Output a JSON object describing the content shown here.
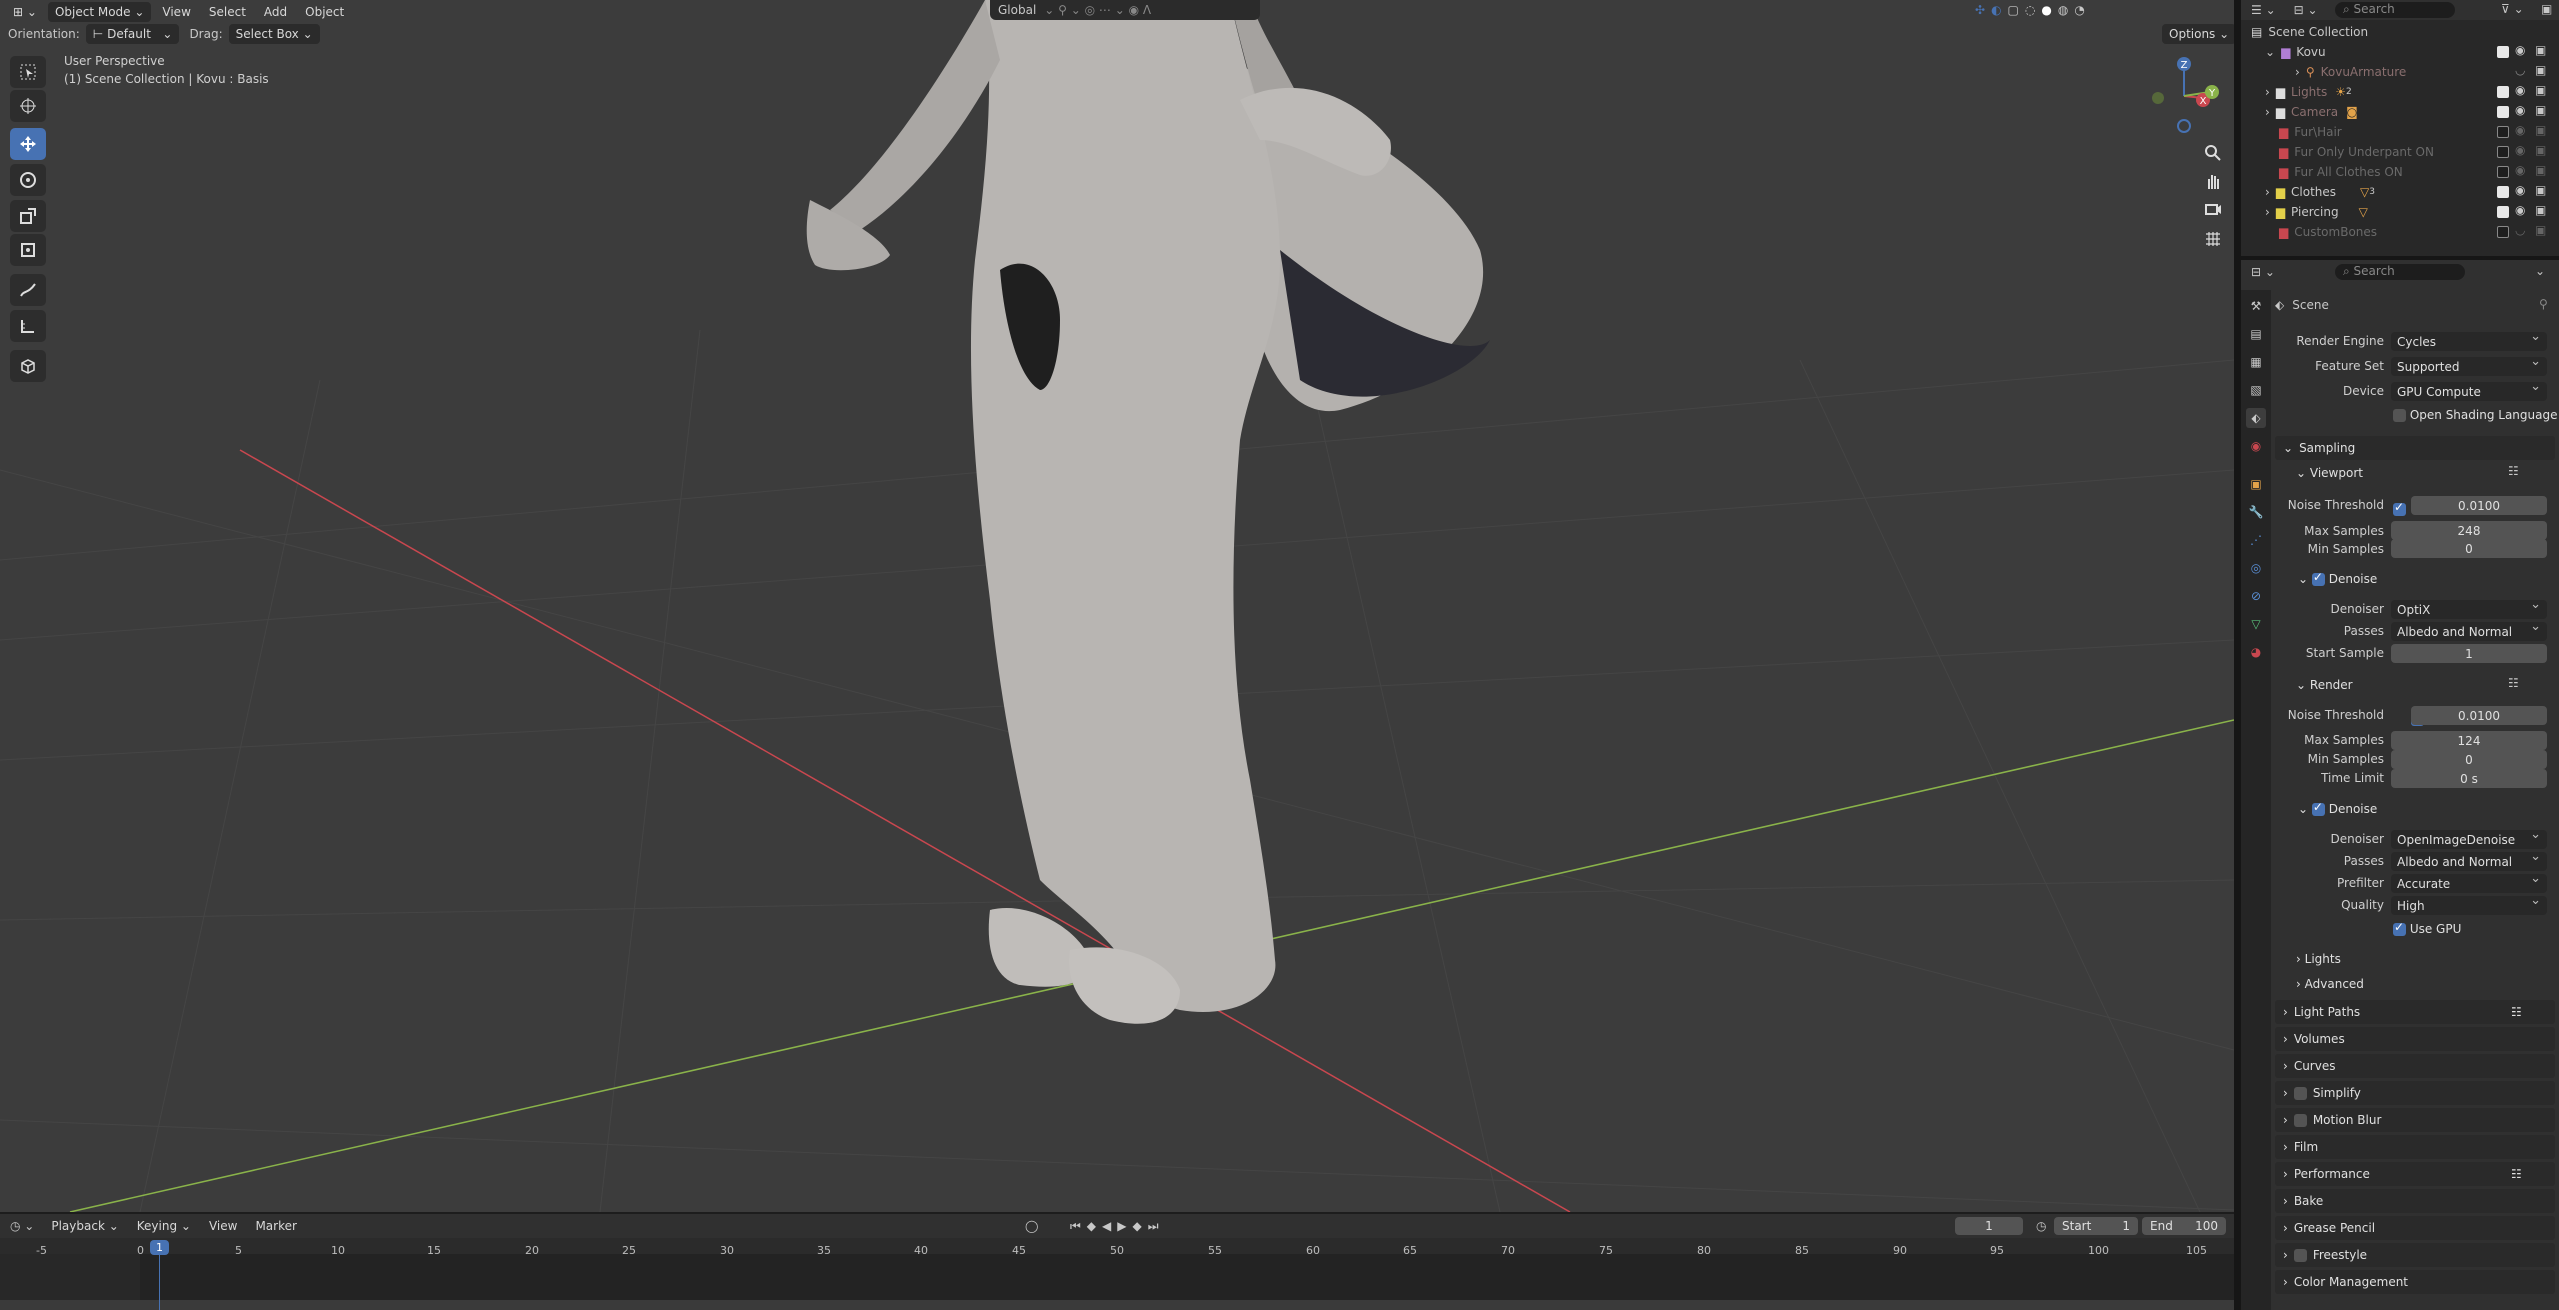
{
  "header": {
    "mode": "Object Mode",
    "menus": [
      "View",
      "Select",
      "Add",
      "Object"
    ],
    "orientation_label": "Orientation:",
    "orientation_value": "Default",
    "drag_label": "Drag:",
    "drag_value": "Select Box",
    "transform_space": "Global",
    "options": "Options",
    "search_placeholder": "Search"
  },
  "viewport": {
    "perspective": "User Perspective",
    "collection_info": "(1) Scene Collection | Kovu : Basis",
    "gizmo_axes": [
      "Z",
      "X",
      "Y"
    ]
  },
  "outliner": {
    "root": "Scene Collection",
    "items": [
      {
        "label": "Kovu",
        "enabled": true
      },
      {
        "label": "KovuArmature",
        "enabled": true
      },
      {
        "label": "Lights",
        "enabled": true,
        "badge": "2"
      },
      {
        "label": "Camera",
        "enabled": true
      },
      {
        "label": "Fur\\Hair",
        "enabled": false
      },
      {
        "label": "Fur Only Underpant ON",
        "enabled": false
      },
      {
        "label": "Fur All Clothes ON",
        "enabled": false
      },
      {
        "label": "Clothes",
        "enabled": true,
        "badge": "3"
      },
      {
        "label": "Piercing",
        "enabled": true
      },
      {
        "label": "CustomBones",
        "enabled": false
      }
    ]
  },
  "properties": {
    "search_placeholder": "Search",
    "context": "Scene",
    "render_engine": {
      "label": "Render Engine",
      "value": "Cycles"
    },
    "feature_set": {
      "label": "Feature Set",
      "value": "Supported"
    },
    "device": {
      "label": "Device",
      "value": "GPU Compute"
    },
    "osl": "Open Shading Language",
    "sampling": "Sampling",
    "viewport": {
      "title": "Viewport",
      "noise_threshold": {
        "label": "Noise Threshold",
        "value": "0.0100"
      },
      "max_samples": {
        "label": "Max Samples",
        "value": "248"
      },
      "min_samples": {
        "label": "Min Samples",
        "value": "0"
      },
      "denoise": "Denoise",
      "denoiser": {
        "label": "Denoiser",
        "value": "OptiX"
      },
      "passes": {
        "label": "Passes",
        "value": "Albedo and Normal"
      },
      "start_sample": {
        "label": "Start Sample",
        "value": "1"
      }
    },
    "render": {
      "title": "Render",
      "noise_threshold": {
        "label": "Noise Threshold",
        "value": "0.0100"
      },
      "max_samples": {
        "label": "Max Samples",
        "value": "124"
      },
      "min_samples": {
        "label": "Min Samples",
        "value": "0"
      },
      "time_limit": {
        "label": "Time Limit",
        "value": "0 s"
      },
      "denoise": "Denoise",
      "denoiser": {
        "label": "Denoiser",
        "value": "OpenImageDenoise"
      },
      "passes": {
        "label": "Passes",
        "value": "Albedo and Normal"
      },
      "prefilter": {
        "label": "Prefilter",
        "value": "Accurate"
      },
      "quality": {
        "label": "Quality",
        "value": "High"
      },
      "use_gpu": "Use GPU"
    },
    "sampling_subpanels": [
      "Lights",
      "Advanced"
    ],
    "panels": [
      "Light Paths",
      "Volumes",
      "Curves",
      "Simplify",
      "Motion Blur",
      "Film",
      "Performance",
      "Bake",
      "Grease Pencil",
      "Freestyle",
      "Color Management"
    ]
  },
  "timeline": {
    "menus": [
      "Playback",
      "Keying",
      "View",
      "Marker"
    ],
    "current_frame": "1",
    "start_label": "Start",
    "start_value": "1",
    "end_label": "End",
    "end_value": "100",
    "ruler": [
      "-5",
      "0",
      "5",
      "10",
      "15",
      "20",
      "25",
      "30",
      "35",
      "40",
      "45",
      "50",
      "55",
      "60",
      "65",
      "70",
      "75",
      "80",
      "85",
      "90",
      "95",
      "100",
      "105"
    ],
    "playhead": "1"
  },
  "colors": {
    "accent": "#4772b3",
    "viewport_bg": "#3c3c3c",
    "x_axis": "#c9474f",
    "y_axis": "#8ab34a",
    "z_axis": "#4772b3"
  }
}
